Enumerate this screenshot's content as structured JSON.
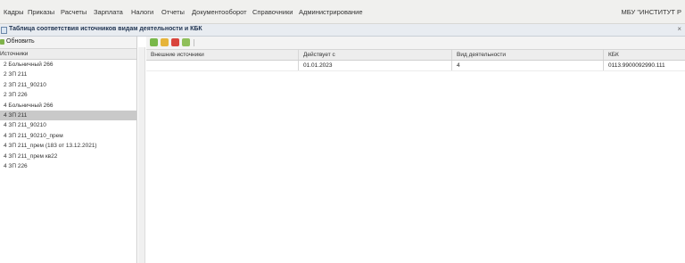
{
  "menu": {
    "items": [
      "Кадры",
      "Приказы",
      "Расчеты",
      "Зарплата",
      "Налоги",
      "Отчеты",
      "Документооборот",
      "Справочники",
      "Администрирование"
    ],
    "org": "МБУ \"ИНСТИТУТ Р"
  },
  "window": {
    "title": "Таблица соответствия источников видам деятельности и КБК"
  },
  "left": {
    "refresh_label": "Обновить",
    "header": "Источники",
    "items": [
      "2 Больничный 266",
      "2 ЗП 211",
      "2 ЗП 211_90210",
      "2 ЗП 226",
      "4 Больничный 266",
      "4 ЗП 211",
      "4 ЗП 211_90210",
      "4 ЗП 211_90210_прем",
      "4 ЗП 211_прем (183 от 13.12.2021)",
      "4 ЗП 211_прем кв22",
      "4 ЗП 226"
    ],
    "selected_index": 5
  },
  "grid": {
    "columns": [
      "Внешние источники",
      "Действует с",
      "Вид деятельности",
      "КБК"
    ],
    "rows": [
      [
        "",
        "01.01.2023",
        "4",
        "0113.9900092990.111"
      ]
    ]
  }
}
